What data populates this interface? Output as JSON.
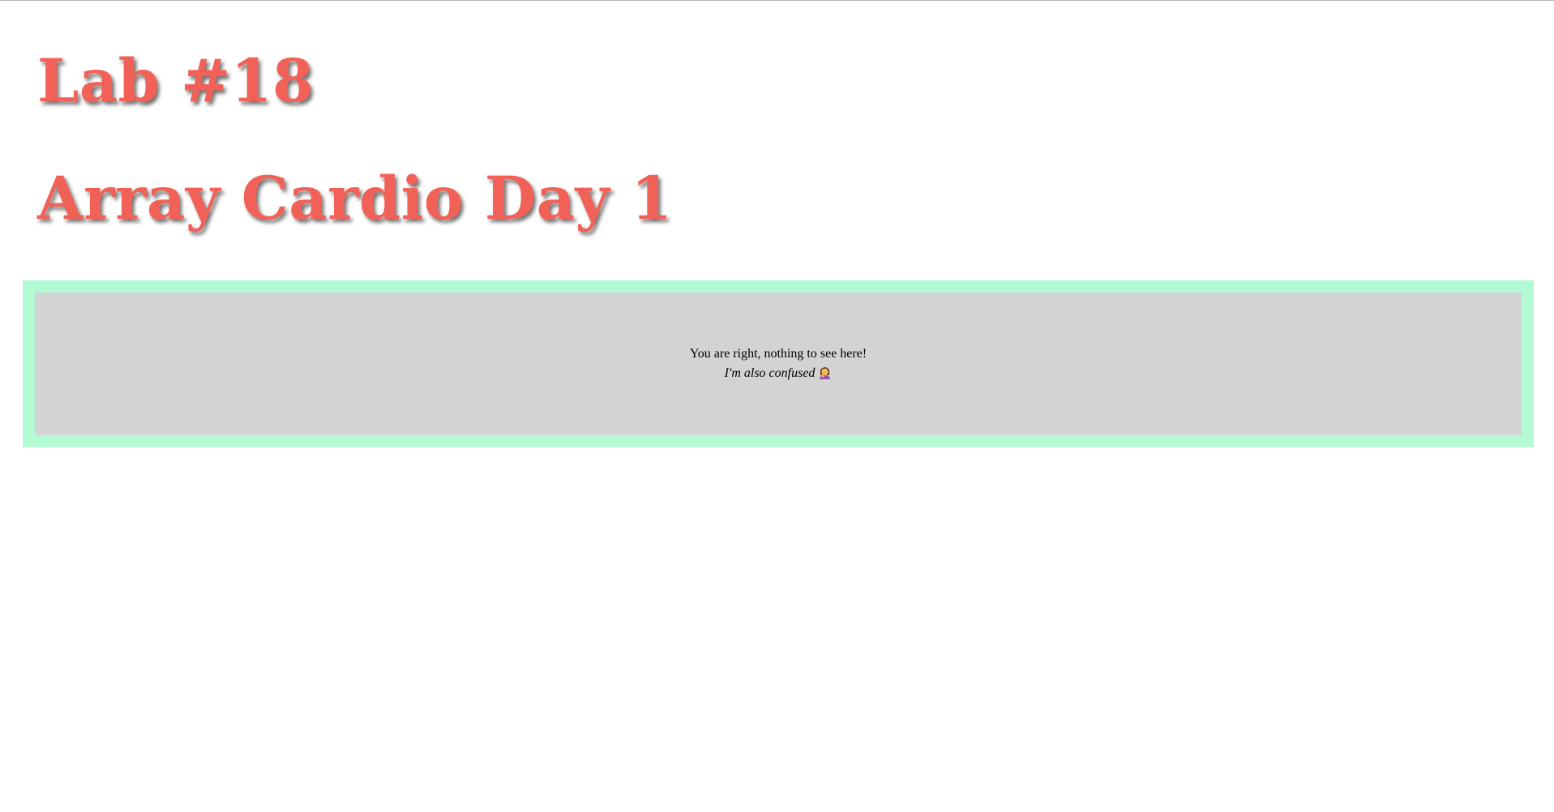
{
  "page": {
    "heading_lab": "Lab #18",
    "heading_title": "Array Cardio Day 1",
    "message_line1": "You are right, nothing to see here!",
    "message_line2": "I'm also confused",
    "message_emoji_icon": "woman-facepalming-icon"
  },
  "colors": {
    "heading": "#f26157",
    "panel_border": "#b4fad4",
    "panel_background": "#d3d3d3",
    "page_background": "#ffffff",
    "text": "#000000"
  }
}
